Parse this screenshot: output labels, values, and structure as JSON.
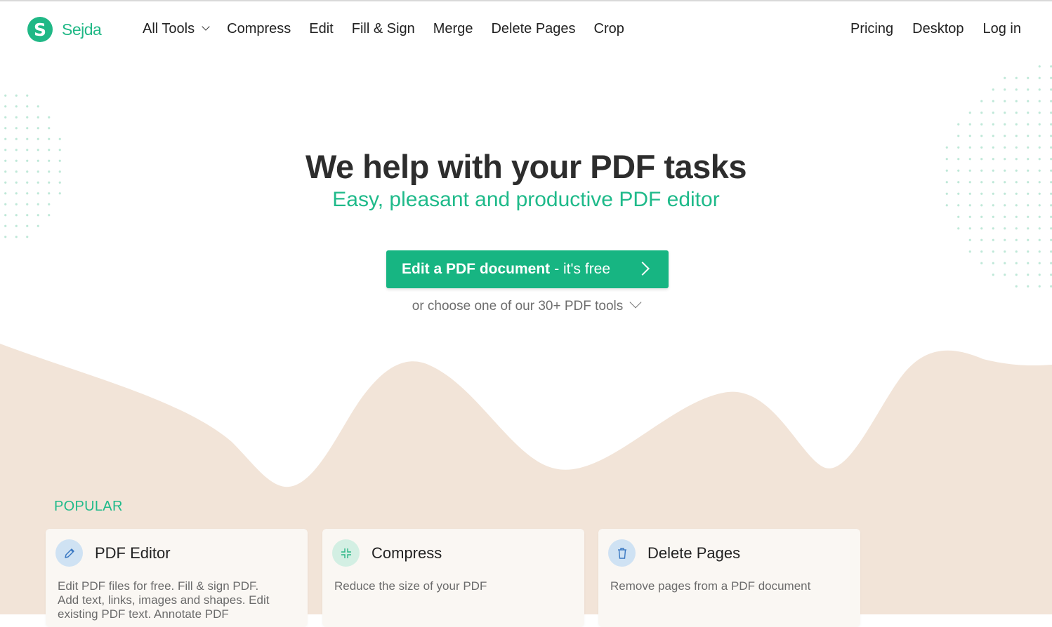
{
  "brand": {
    "name": "Sejda",
    "logo_letter": "S",
    "accent": "#20b886"
  },
  "nav": {
    "left": [
      "All Tools",
      "Compress",
      "Edit",
      "Fill & Sign",
      "Merge",
      "Delete Pages",
      "Crop"
    ],
    "right": [
      "Pricing",
      "Desktop",
      "Log in"
    ]
  },
  "hero": {
    "title": "We help with your PDF tasks",
    "subtitle": "Easy, pleasant and productive PDF editor",
    "cta_strong": "Edit a PDF document",
    "cta_light": "- it's free",
    "choose_text": "or choose one of our 30+ PDF tools"
  },
  "popular": {
    "heading": "POPULAR",
    "cards": [
      {
        "title": "PDF Editor",
        "description": "Edit PDF files for free. Fill & sign PDF. Add text, links, images and shapes. Edit existing PDF text. Annotate PDF",
        "icon": "pencil-icon",
        "icon_bg": "#cfe2f3",
        "icon_color": "#3a78c2"
      },
      {
        "title": "Compress",
        "description": "Reduce the size of your PDF",
        "icon": "compress-icon",
        "icon_bg": "#d3efe3",
        "icon_color": "#2bb585"
      },
      {
        "title": "Delete Pages",
        "description": "Remove pages from a PDF document",
        "icon": "trash-icon",
        "icon_bg": "#cfe2f3",
        "icon_color": "#3a78c2"
      }
    ]
  },
  "colors": {
    "wave": "#f2e4d8",
    "dots": "#bfe8d8",
    "cta": "#17b582"
  }
}
